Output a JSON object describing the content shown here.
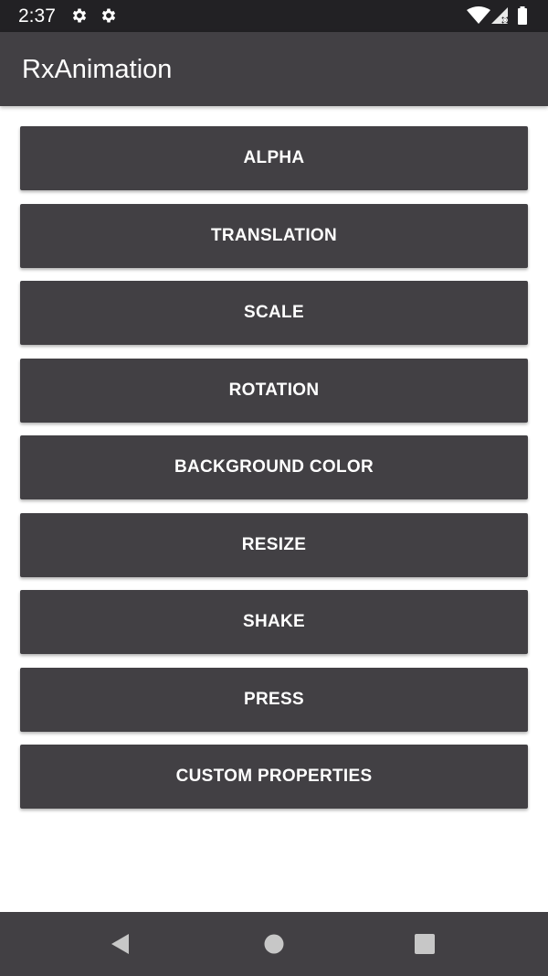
{
  "status_bar": {
    "time": "2:37",
    "left_icons": [
      "gear-icon",
      "gear-icon"
    ],
    "right_icons": [
      "wifi-icon",
      "cell-signal-icon",
      "battery-icon"
    ]
  },
  "app_bar": {
    "title": "RxAnimation"
  },
  "buttons": [
    {
      "label": "ALPHA"
    },
    {
      "label": "TRANSLATION"
    },
    {
      "label": "SCALE"
    },
    {
      "label": "ROTATION"
    },
    {
      "label": "BACKGROUND COLOR"
    },
    {
      "label": "RESIZE"
    },
    {
      "label": "SHAKE"
    },
    {
      "label": "PRESS"
    },
    {
      "label": "CUSTOM PROPERTIES"
    }
  ],
  "nav_bar": {
    "icons": [
      "back-icon",
      "home-icon",
      "recents-icon"
    ]
  },
  "colors": {
    "status_bar": "#222124",
    "app_bar": "#424044",
    "button": "#424044",
    "button_text": "#ffffff",
    "background": "#ffffff",
    "nav_icon": "#c7c7c7"
  }
}
